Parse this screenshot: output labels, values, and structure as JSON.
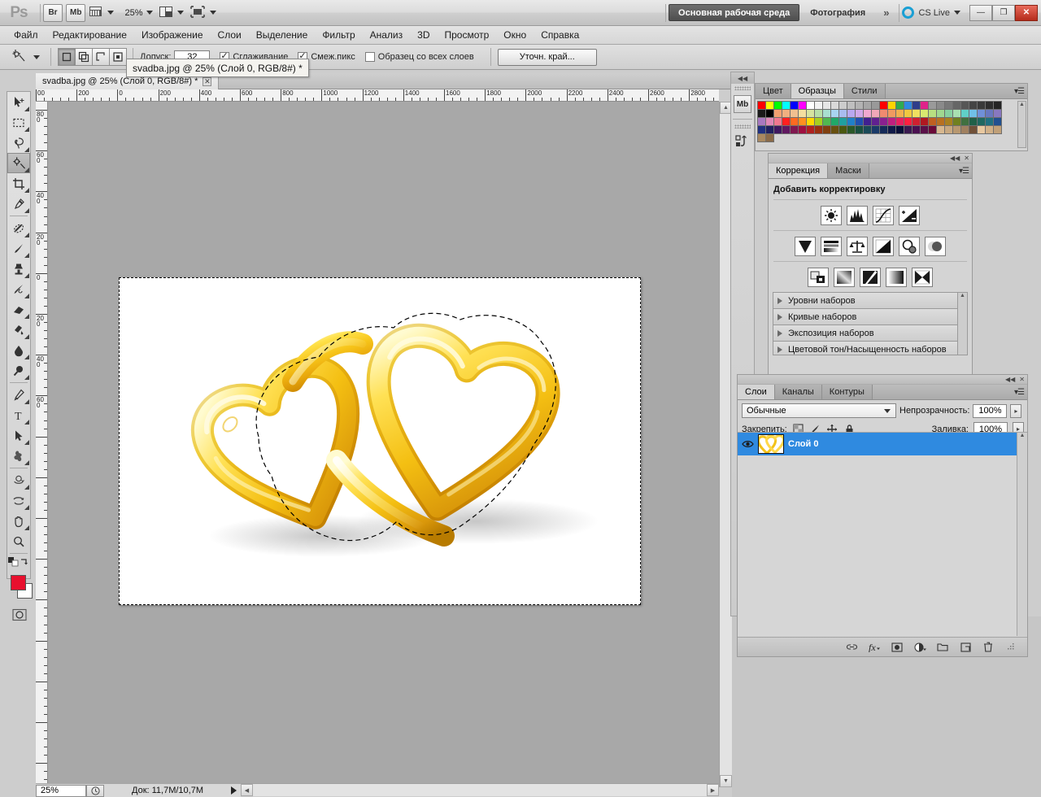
{
  "appbar": {
    "logo": "Ps",
    "bridge_label": "Br",
    "minibridge_label": "Mb",
    "view_extras_icon": "view-extras-icon",
    "zoom_level": "25%",
    "screen_mode_icon": "screen-mode-icon",
    "arrange_icon": "arrange-documents-icon",
    "workspaces": [
      {
        "label": "Основная рабочая среда",
        "active": true
      },
      {
        "label": "Фотография",
        "active": false
      }
    ],
    "more_workspaces": "»",
    "cslive_label": "CS Live",
    "window_controls": {
      "minimize": "—",
      "restore": "❐",
      "close": "✕"
    }
  },
  "menubar": {
    "items": [
      "Файл",
      "Редактирование",
      "Изображение",
      "Слои",
      "Выделение",
      "Фильтр",
      "Анализ",
      "3D",
      "Просмотр",
      "Окно",
      "Справка"
    ]
  },
  "optionsbar": {
    "tool_icon": "magic-wand-icon",
    "selection_modes": [
      {
        "name": "new-selection",
        "active": true
      },
      {
        "name": "add-to-selection",
        "active": false
      },
      {
        "name": "subtract-from-selection",
        "active": false
      },
      {
        "name": "intersect-selection",
        "active": false
      }
    ],
    "tolerance_label": "Допуск:",
    "tolerance_value": "32",
    "antialias_label": "Сглаживание",
    "antialias_checked": true,
    "contiguous_label": "Смеж.пикс",
    "contiguous_checked": true,
    "sample_all_layers_label": "Образец со всех слоев",
    "sample_all_layers_checked": false,
    "refine_edge_label": "Уточн. край..."
  },
  "tooltip": {
    "text": "svadba.jpg @ 25% (Слой 0, RGB/8#) *"
  },
  "document": {
    "tab_title": "svadba.jpg @ 25% (Слой 0, RGB/8#) *",
    "tab_close": "✕",
    "ruler_h_labels": [
      "00",
      "200",
      "0",
      "200",
      "400",
      "600",
      "800",
      "1000",
      "1200",
      "1400",
      "1600",
      "1800",
      "2000",
      "2200",
      "2400",
      "2600",
      "2800"
    ],
    "ruler_v_labels": [
      "800",
      "600",
      "400",
      "200",
      "0",
      "200",
      "400",
      "600"
    ],
    "canvas_image": "two-interlocking-gold-heart-rings"
  },
  "statusbar": {
    "zoom": "25%",
    "timing_icon": "clock-icon",
    "doc_info": "Док: 11,7M/10,7M",
    "expand_icon": "play-triangle-icon"
  },
  "dock_strip": {
    "minibridge_label": "Mb",
    "history_icon": "history-icon"
  },
  "swatches_panel": {
    "tabs": [
      {
        "label": "Цвет",
        "active": false
      },
      {
        "label": "Образцы",
        "active": true
      },
      {
        "label": "Стили",
        "active": false
      }
    ],
    "menu_icon": "panel-menu-icon",
    "colors_row1": [
      "#ff0000",
      "#ffff00",
      "#00ff00",
      "#00ffff",
      "#0000ff",
      "#ff00ff",
      "#ffffff",
      "#f2f2f2",
      "#e6e6e6",
      "#d9d9d9",
      "#cccccc",
      "#bfbfbf",
      "#b3b3b3",
      "#a6a6a6",
      "#999999",
      "#ff0000",
      "#ffd400",
      "#2fab4f",
      "#2f8ae0",
      "#2f3d8a",
      "#e0238a",
      "#9a9a9a",
      "#8a8a8a",
      "#787878",
      "#666666",
      "#565656",
      "#444444"
    ],
    "colors_row2": [
      "#3a3a3a",
      "#2e2e2e",
      "#242424",
      "#1a1a1a",
      "#000000",
      "#f0a070",
      "#f0b080",
      "#f0c090",
      "#f5dfa0",
      "#d7e4a0",
      "#b8dfa8",
      "#a8dfd0",
      "#a8d4f0",
      "#a8bcf0",
      "#b8a8f0",
      "#d0a8e8",
      "#f0a8d0",
      "#f0a8b8",
      "#f08a70",
      "#f09a60",
      "#f0b050",
      "#f0c840",
      "#f0e060",
      "#d8e870",
      "#b8e080",
      "#a0d890",
      "#88d0a0"
    ],
    "colors_row3": [
      "#a8e0b0",
      "#60d0c8",
      "#70c0e8",
      "#7090d8",
      "#6878c0",
      "#8878c0",
      "#a878c0",
      "#e088b8",
      "#f07890",
      "#ff2020",
      "#ff6a20",
      "#ff9020",
      "#ffd800",
      "#a8d020",
      "#50b850",
      "#20a868",
      "#20a0a0",
      "#2080c8",
      "#2050b0",
      "#402090",
      "#602090",
      "#8a2090",
      "#c02080",
      "#e82060",
      "#ff2040",
      "#d02030",
      "#b01820"
    ],
    "colors_row4": [
      "#c06020",
      "#b87020",
      "#a88020",
      "#708020",
      "#407040",
      "#206048",
      "#206860",
      "#207080",
      "#205090",
      "#203080",
      "#202060",
      "#401860",
      "#601860",
      "#801850",
      "#a01040",
      "#b02020",
      "#9a3010",
      "#804010",
      "#685010",
      "#4a5810",
      "#2a5828",
      "#1a5040",
      "#1a4a58",
      "#1a3a68",
      "#152a58",
      "#101a48",
      "#0a1038"
    ],
    "colors_row5": [
      "#3a1a50",
      "#4a1050",
      "#5a1048",
      "#6a0a38",
      "#d8b890",
      "#c8a880",
      "#b89870",
      "#a08060",
      "#705038",
      "#e8c8a0",
      "#d0b088",
      "#c0a078",
      "#a88860",
      "#8a6a48"
    ]
  },
  "adjustments_panel": {
    "tabs": [
      {
        "label": "Коррекция",
        "active": true
      },
      {
        "label": "Маски",
        "active": false
      }
    ],
    "menu_icon": "panel-menu-icon",
    "title": "Добавить корректировку",
    "row1_icons": [
      "brightness-contrast-icon",
      "levels-icon",
      "curves-icon",
      "exposure-icon"
    ],
    "row2_icons": [
      "vibrance-icon",
      "hue-saturation-icon",
      "color-balance-icon",
      "black-white-icon",
      "photo-filter-icon",
      "channel-mixer-icon"
    ],
    "row3_icons": [
      "invert-icon",
      "posterize-icon",
      "threshold-icon",
      "gradient-map-icon",
      "selective-color-icon"
    ],
    "presets": [
      "Уровни наборов",
      "Кривые наборов",
      "Экспозиция наборов",
      "Цветовой тон/Насыщенность наборов"
    ]
  },
  "layers_panel": {
    "tabs": [
      {
        "label": "Слои",
        "active": true
      },
      {
        "label": "Каналы",
        "active": false
      },
      {
        "label": "Контуры",
        "active": false
      }
    ],
    "menu_icon": "panel-menu-icon",
    "blend_mode": "Обычные",
    "opacity_label": "Непрозрачность:",
    "opacity_value": "100%",
    "lock_label": "Закрепить:",
    "lock_icons": [
      "lock-transparent-pixels-icon",
      "lock-image-pixels-icon",
      "lock-position-icon",
      "lock-all-icon"
    ],
    "fill_label": "Заливка:",
    "fill_value": "100%",
    "layers": [
      {
        "name": "Слой 0",
        "visible": true,
        "selected": true,
        "thumb": "gold-rings-thumb"
      }
    ],
    "footer_icons": [
      "link-layers-icon",
      "layer-style-fx-icon",
      "add-layer-mask-icon",
      "new-adjustment-layer-icon",
      "new-group-icon",
      "new-layer-icon",
      "delete-layer-icon"
    ]
  },
  "colors": {
    "accent_selection": "#2f8ae0",
    "foreground_swatch": "#e8102e",
    "background_swatch": "#ffffff",
    "close_button": "#b52b1b",
    "cslive_blue": "#1a9fd4"
  }
}
